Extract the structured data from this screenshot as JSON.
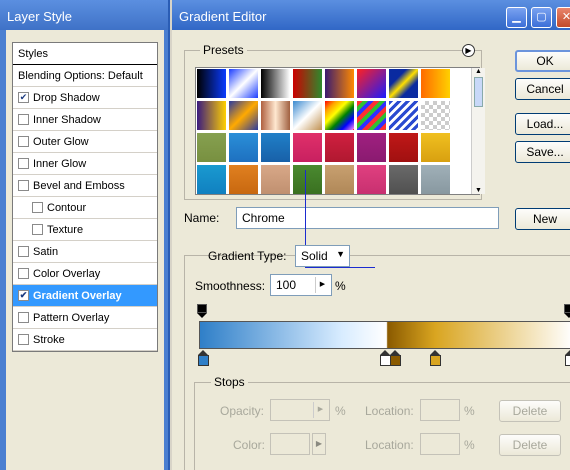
{
  "layer_style": {
    "title": "Layer Style",
    "styles_header": "Styles",
    "blending": "Blending Options: Default",
    "items": [
      {
        "label": "Drop Shadow",
        "checked": true,
        "sub": false,
        "selected": false
      },
      {
        "label": "Inner Shadow",
        "checked": false,
        "sub": false,
        "selected": false
      },
      {
        "label": "Outer Glow",
        "checked": false,
        "sub": false,
        "selected": false
      },
      {
        "label": "Inner Glow",
        "checked": false,
        "sub": false,
        "selected": false
      },
      {
        "label": "Bevel and Emboss",
        "checked": false,
        "sub": false,
        "selected": false
      },
      {
        "label": "Contour",
        "checked": false,
        "sub": true,
        "selected": false
      },
      {
        "label": "Texture",
        "checked": false,
        "sub": true,
        "selected": false
      },
      {
        "label": "Satin",
        "checked": false,
        "sub": false,
        "selected": false
      },
      {
        "label": "Color Overlay",
        "checked": false,
        "sub": false,
        "selected": false
      },
      {
        "label": "Gradient Overlay",
        "checked": true,
        "sub": false,
        "selected": true
      },
      {
        "label": "Pattern Overlay",
        "checked": false,
        "sub": false,
        "selected": false
      },
      {
        "label": "Stroke",
        "checked": false,
        "sub": false,
        "selected": false
      }
    ]
  },
  "editor": {
    "title": "Gradient Editor",
    "presets_label": "Presets",
    "buttons": {
      "ok": "OK",
      "cancel": "Cancel",
      "load": "Load...",
      "save": "Save...",
      "new": "New"
    },
    "name_label": "Name:",
    "name_value": "Chrome",
    "gradient_type_label": "Gradient Type:",
    "gradient_type_value": "Solid",
    "smoothness_label": "Smoothness:",
    "smoothness_value": "100",
    "smoothness_unit": "%",
    "stops": {
      "label": "Stops",
      "opacity_label": "Opacity:",
      "pct": "%",
      "location_label": "Location:",
      "delete_label": "Delete",
      "color_label": "Color:"
    }
  },
  "colors": {
    "title_bar": "#3167c6",
    "selected_item": "#3399ff",
    "gradient_stops": [
      "#2f7fc8",
      "#d8ecff",
      "#ffffff",
      "#8a5a00",
      "#d9a520",
      "#ffffff"
    ]
  }
}
